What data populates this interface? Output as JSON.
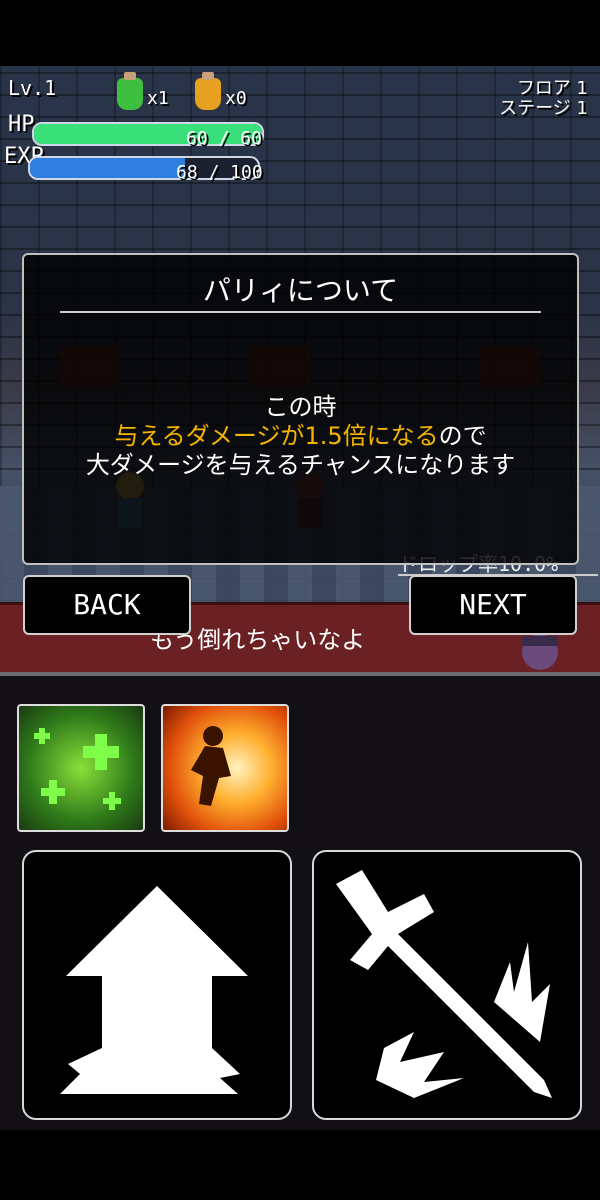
{
  "hud": {
    "level": "Lv.1",
    "potions": [
      {
        "name": "green-potion",
        "count": "x1",
        "color": "#3fbf3f"
      },
      {
        "name": "orange-potion",
        "count": "x0",
        "color": "#e8a020"
      }
    ],
    "floor": "フロア 1",
    "stage": "ステージ 1",
    "hp": {
      "label": "HP",
      "text": "60 / 60",
      "fraction": 1.0,
      "color": "#39e07a"
    },
    "exp": {
      "label": "EXP",
      "text": "68 / 100",
      "fraction": 0.68,
      "color": "#2f7fe0"
    }
  },
  "dialog": {
    "title": "パリィについて",
    "line1": "この時",
    "line2_highlight": "与えるダメージが1.5倍になる",
    "line2_rest": "ので",
    "line3": "大ダメージを与えるチャンスになります"
  },
  "nav": {
    "back": "BACK",
    "next": "NEXT"
  },
  "drop_rate": "ドロップ率10.0%",
  "enemy_message": "もう倒れちゃいなよ",
  "skills": [
    {
      "name": "heal-skill",
      "icon": "heal-icon"
    },
    {
      "name": "fire-skill",
      "icon": "fire-icon"
    }
  ],
  "actions": [
    {
      "name": "jump-button",
      "icon": "up-arrow-icon"
    },
    {
      "name": "attack-button",
      "icon": "sword-icon"
    }
  ],
  "colors": {
    "highlight": "#f5b400",
    "message_band": "#6b2023"
  }
}
